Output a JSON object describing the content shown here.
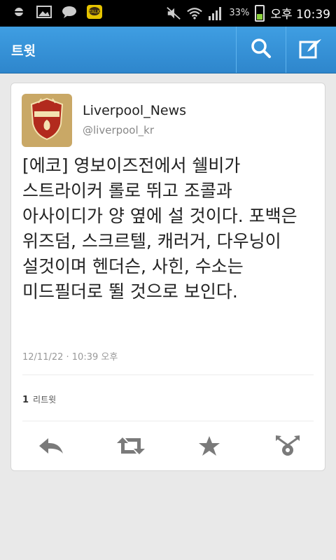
{
  "status_bar": {
    "battery_percent": "33%",
    "time": "오후 10:39",
    "icons": [
      "notification-icon",
      "gallery-icon",
      "chat-icon",
      "kakaotalk-icon",
      "mute-icon",
      "wifi-icon",
      "signal-icon",
      "battery-icon"
    ]
  },
  "action_bar": {
    "title": "트윗",
    "icons": [
      "search-icon",
      "compose-icon"
    ]
  },
  "tweet": {
    "display_name": "Liverpool_News",
    "handle": "@liverpool_kr",
    "text": "[에코] 영보이즈전에서 쉘비가 스트라이커 롤로 뛰고 조콜과 아사이디가 양 옆에 설 것이다. 포백은 위즈덤, 스크르텔, 캐러거, 다우닝이 설것이며 헨더슨, 사힌, 수소는 미드필더로 뛸 것으로 보인다.",
    "timestamp": "12/11/22 · 10:39 오후",
    "retweet_count": "1",
    "retweet_label": "리트윗",
    "avatar_icon": "liverpool-crest-icon"
  },
  "actions": [
    "reply-icon",
    "retweet-icon",
    "favorite-icon",
    "share-icon"
  ],
  "colors": {
    "action_bar": "#3393d8",
    "background": "#e9e9e9"
  }
}
